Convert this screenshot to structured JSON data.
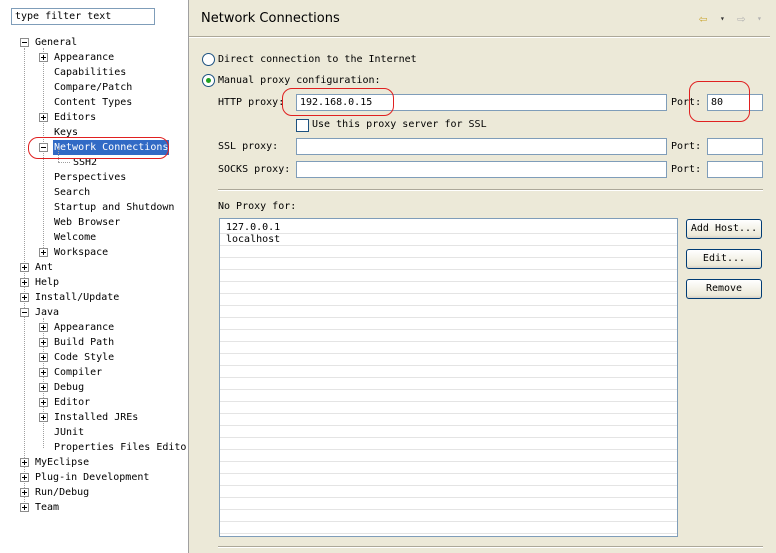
{
  "filter": {
    "value": "type filter text"
  },
  "tree": {
    "general": "General",
    "general_children": [
      "Appearance",
      "Capabilities",
      "Compare/Patch",
      "Content Types",
      "Editors",
      "Keys",
      "Network Connections",
      "SSH2",
      "Perspectives",
      "Search",
      "Startup and Shutdown",
      "Web Browser",
      "Welcome",
      "Workspace"
    ],
    "top": [
      "Ant",
      "Help",
      "Install/Update"
    ],
    "java": "Java",
    "java_children": [
      "Appearance",
      "Build Path",
      "Code Style",
      "Compiler",
      "Debug",
      "Editor",
      "Installed JREs",
      "JUnit",
      "Properties Files Edito"
    ],
    "bottom": [
      "MyEclipse",
      "Plug-in Development",
      "Run/Debug",
      "Team"
    ]
  },
  "page": {
    "title": "Network Connections"
  },
  "nav": {
    "back": "⇦",
    "menu": "▾",
    "forward": "⇨"
  },
  "proxy": {
    "direct_label": "Direct connection to the Internet",
    "manual_label": "Manual proxy configuration:",
    "http_label": "HTTP proxy:",
    "http_value": "192.168.0.15",
    "port_label": "Port:",
    "http_port": "80",
    "use_for_ssl_label": "Use this proxy server for SSL",
    "ssl_label": "SSL proxy:",
    "ssl_value": "",
    "ssl_port": "",
    "socks_label": "SOCKS proxy:",
    "socks_value": "",
    "socks_port": ""
  },
  "no_proxy": {
    "label": "No Proxy for:",
    "hosts": [
      "127.0.0.1",
      "localhost"
    ]
  },
  "buttons": {
    "add_host": "Add Host...",
    "edit": "Edit...",
    "remove": "Remove"
  },
  "colors": {
    "selection": "#316ac5",
    "annotation": "#e02020",
    "radio_dot": "#21a121"
  }
}
